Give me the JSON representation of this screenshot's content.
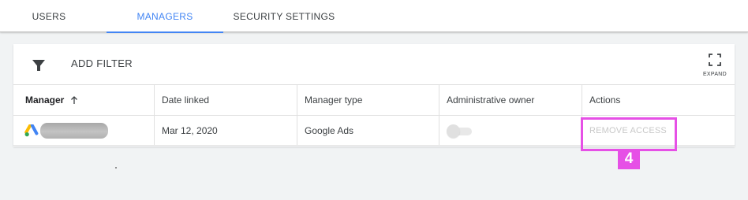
{
  "tabs": {
    "users": "USERS",
    "managers": "MANAGERS",
    "security_settings": "SECURITY SETTINGS",
    "active": "MANAGERS"
  },
  "toolbar": {
    "add_filter_label": "ADD FILTER",
    "expand_label": "EXPAND"
  },
  "table": {
    "columns": [
      "Manager",
      "Date linked",
      "Manager type",
      "Administrative owner",
      "Actions"
    ],
    "sorted_column": "Manager",
    "rows": [
      {
        "manager_icon": "google-ads-icon",
        "manager_name_redacted": true,
        "date_linked": "Mar 12, 2020",
        "manager_type": "Google Ads",
        "administrative_owner": false,
        "action_label": "REMOVE ACCESS"
      }
    ]
  },
  "annotation": {
    "step_number": "4",
    "color": "#e650e6"
  },
  "colors": {
    "accent": "#4285f4",
    "ads_blue": "#4285f4",
    "ads_yellow": "#fbbc04",
    "ads_green": "#34a853"
  }
}
